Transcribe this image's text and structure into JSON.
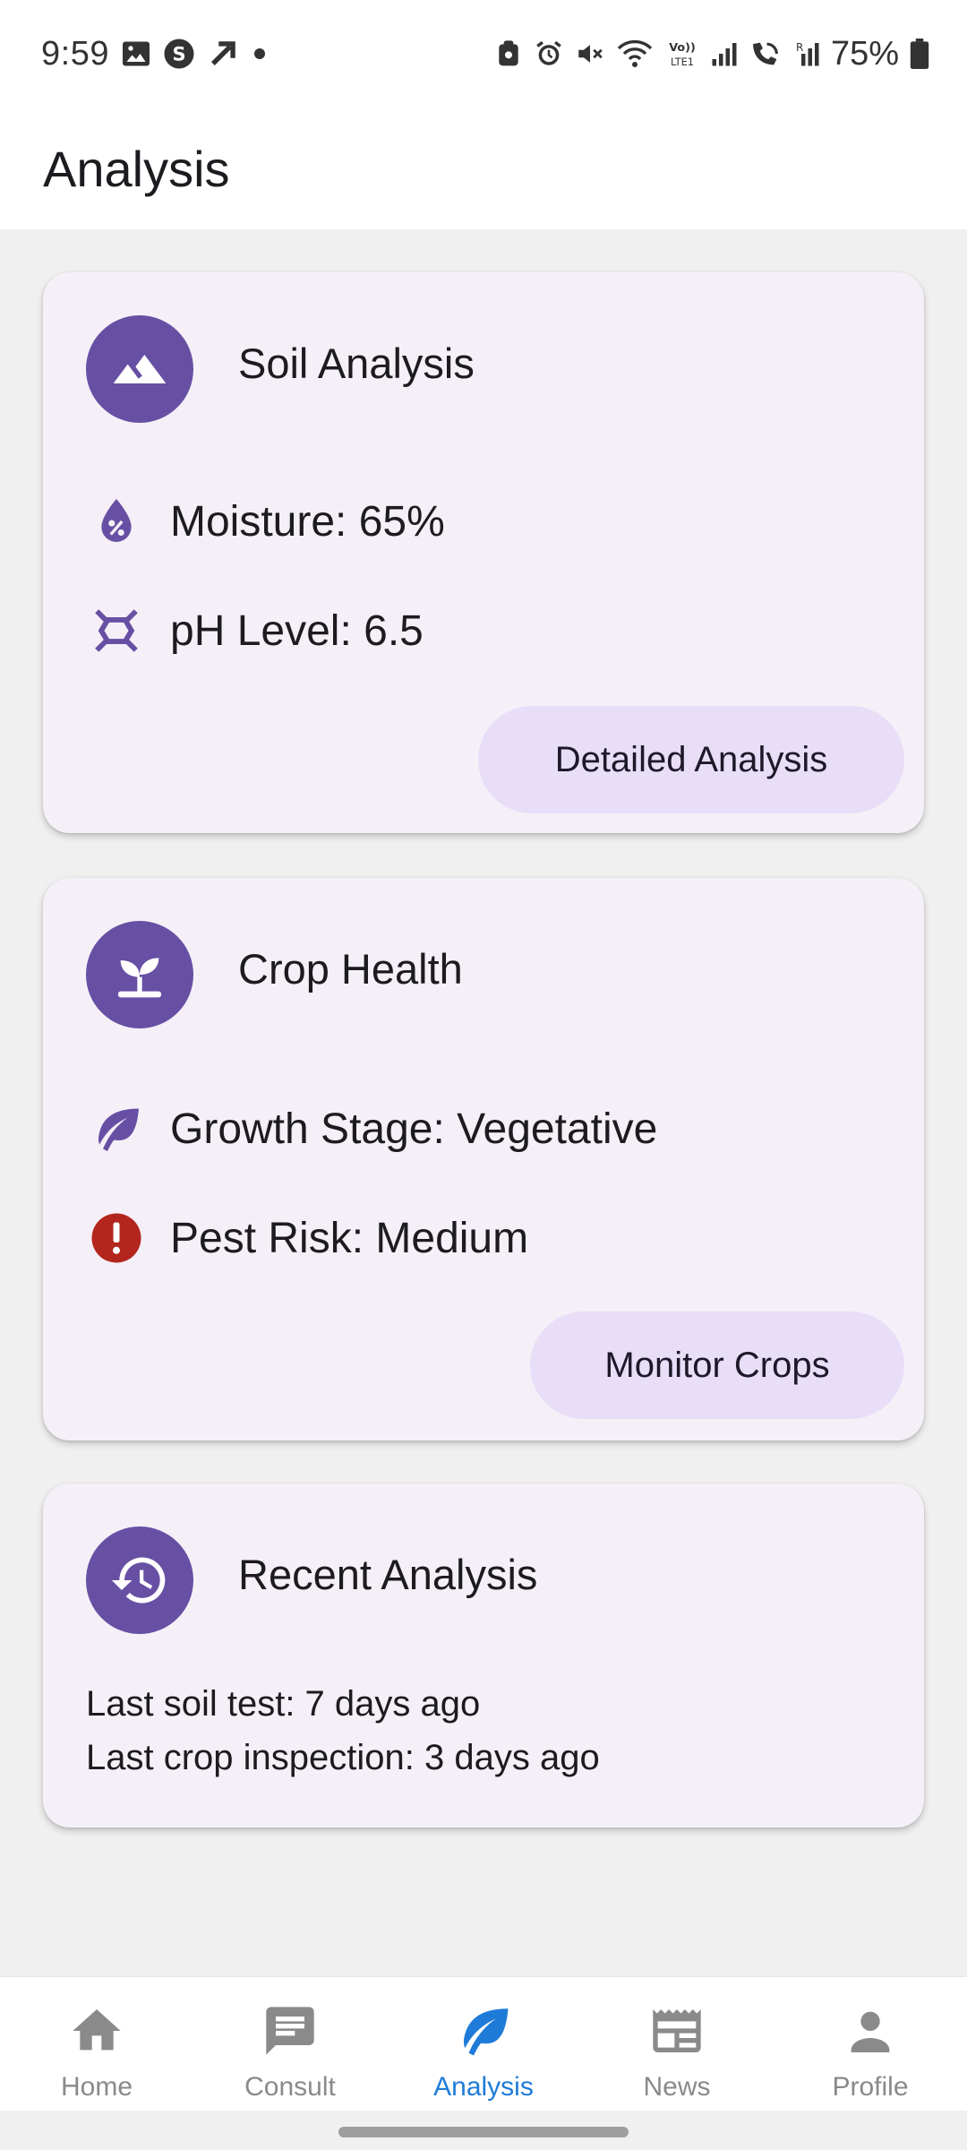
{
  "status_bar": {
    "time": "9:59",
    "battery": "75%"
  },
  "app_bar": {
    "title": "Analysis"
  },
  "cards": [
    {
      "title": "Soil Analysis",
      "icon": "terrain-icon",
      "rows": [
        {
          "icon": "moisture-drop-icon",
          "text": "Moisture: 65%"
        },
        {
          "icon": "molecule-icon",
          "text": "pH Level: 6.5"
        }
      ],
      "button": "Detailed Analysis"
    },
    {
      "title": "Crop Health",
      "icon": "sprout-icon",
      "rows": [
        {
          "icon": "leaf-icon",
          "text": "Growth Stage: Vegetative"
        },
        {
          "icon": "alert-icon",
          "text": "Pest Risk: Medium"
        }
      ],
      "button": "Monitor Crops"
    },
    {
      "title": "Recent Analysis",
      "icon": "history-icon",
      "lines": [
        "Last soil test: 7 days ago",
        "Last crop inspection: 3 days ago"
      ]
    }
  ],
  "bottom_nav": [
    {
      "label": "Home",
      "icon": "home-icon",
      "active": false
    },
    {
      "label": "Consult",
      "icon": "chat-icon",
      "active": false
    },
    {
      "label": "Analysis",
      "icon": "leaf-icon",
      "active": true
    },
    {
      "label": "News",
      "icon": "newspaper-icon",
      "active": false
    },
    {
      "label": "Profile",
      "icon": "person-icon",
      "active": false
    }
  ],
  "colors": {
    "primary": "#6750a4",
    "card_bg": "#f5f0f8",
    "button_bg": "#e8def8",
    "alert": "#b3261e",
    "nav_active": "#1e7bd8",
    "nav_inactive": "#8a8a8a"
  }
}
